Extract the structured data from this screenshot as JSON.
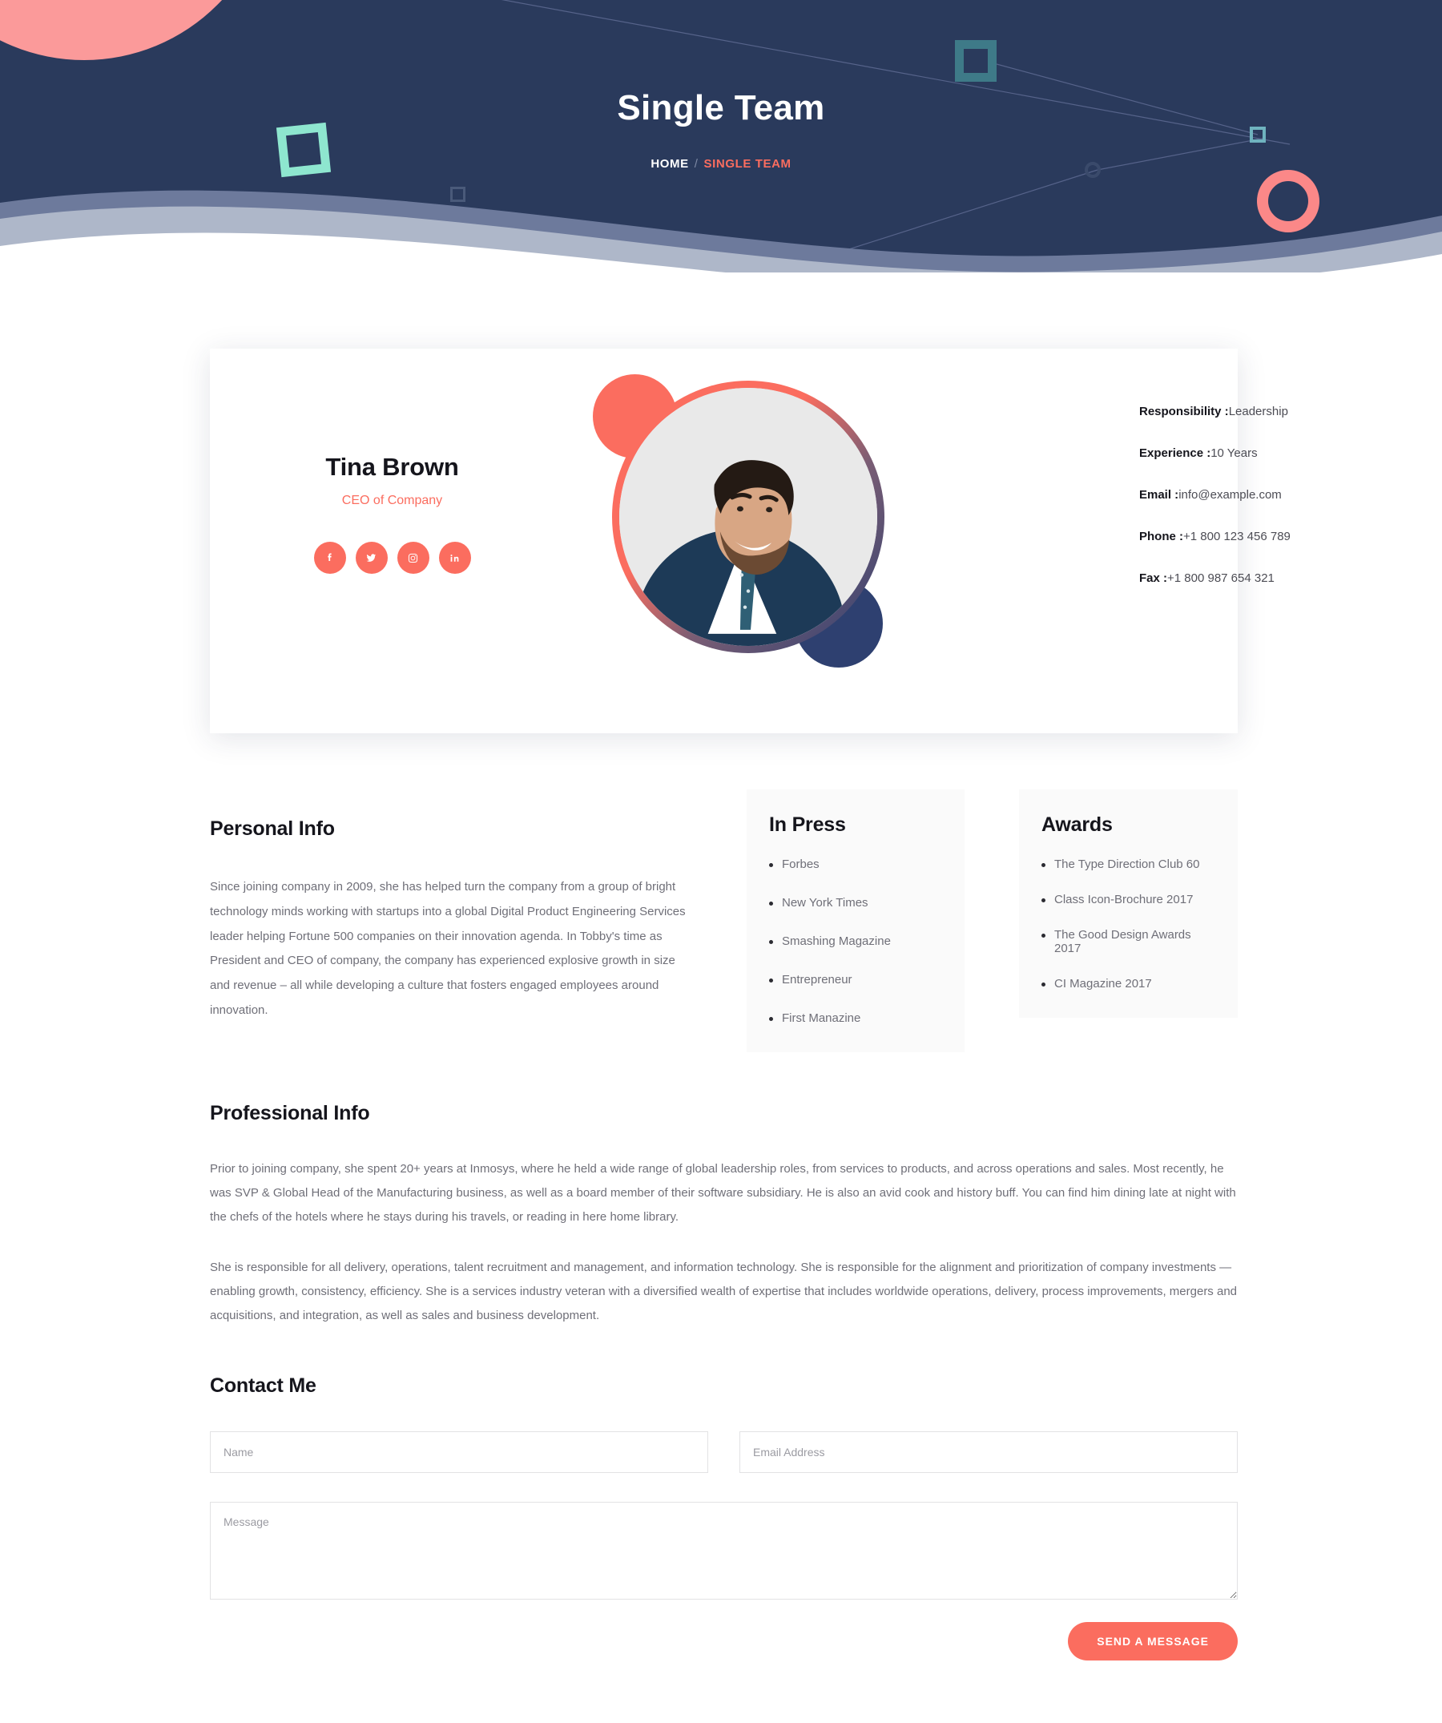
{
  "hero": {
    "title": "Single Team",
    "breadcrumb": {
      "home": "HOME",
      "separator": "/",
      "current": "SINGLE TEAM"
    }
  },
  "profile": {
    "name": "Tina Brown",
    "role": "CEO of Company",
    "socials": [
      {
        "name": "facebook",
        "label": "Facebook"
      },
      {
        "name": "twitter",
        "label": "Twitter"
      },
      {
        "name": "instagram",
        "label": "Instagram"
      },
      {
        "name": "linkedin",
        "label": "LinkedIn"
      }
    ],
    "details": [
      {
        "label": "Responsibility :",
        "value": "Leadership"
      },
      {
        "label": "Experience :",
        "value": "10 Years"
      },
      {
        "label": "Email :",
        "value": "info@example.com"
      },
      {
        "label": "Phone :",
        "value": "+1 800 123 456 789"
      },
      {
        "label": "Fax :",
        "value": "+1 800 987 654 321"
      }
    ]
  },
  "personal_info": {
    "title": "Personal Info",
    "body": "Since joining company in 2009, she has helped turn the company from a group of bright technology minds working with startups into a global Digital Product Engineering Services leader helping Fortune 500 companies on their innovation agenda. In Tobby's time as President and CEO of company, the company has experienced explosive growth in size and revenue – all while developing a culture that fosters engaged employees around innovation."
  },
  "in_press": {
    "title": "In Press",
    "items": [
      "Forbes",
      "New York Times",
      "Smashing Magazine",
      "Entrepreneur",
      "First Manazine"
    ]
  },
  "awards": {
    "title": "Awards",
    "items": [
      "The Type Direction Club 60",
      "Class Icon-Brochure 2017",
      "The Good Design Awards 2017",
      "CI Magazine 2017"
    ]
  },
  "professional_info": {
    "title": "Professional Info",
    "paragraph1": "Prior to joining company, she spent 20+ years at Inmosys, where he held a wide range of global leadership roles, from services to products, and across operations and sales. Most recently, he was SVP & Global Head of the Manufacturing business, as well as a board member of their software subsidiary. He is also an avid cook and history buff. You can find him dining late at night with the chefs of the hotels where he stays during his travels, or reading in here home library.",
    "paragraph2": "She is responsible for all delivery, operations, talent recruitment and management, and information technology. She is responsible for the alignment and prioritization of company investments — enabling growth, consistency, efficiency. She is a services industry veteran with a diversified wealth of expertise that includes worldwide operations, delivery, process improvements, mergers and acquisitions, and integration, as well as sales and business development."
  },
  "contact": {
    "title": "Contact Me",
    "name_placeholder": "Name",
    "name_value": "",
    "email_placeholder": "Email Address",
    "email_value": "",
    "message_placeholder": "Message",
    "message_value": "",
    "submit_label": "SEND A MESSAGE"
  },
  "colors": {
    "navy": "#2a3a5c",
    "coral": "#fb6d5f",
    "pink": "#fb9a9a",
    "mint": "#8ee6cf",
    "teal": "#3e7a88",
    "panel_bg": "#fafafa"
  }
}
